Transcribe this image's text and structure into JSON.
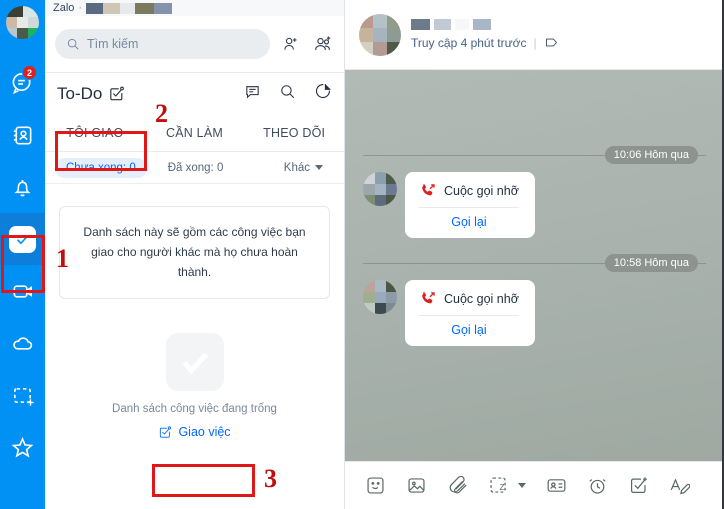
{
  "app": {
    "title": "Zalo",
    "accent": "#0190f3",
    "link_color": "#0068ff",
    "annotation_color": "#e11717"
  },
  "rail": {
    "avatar": {
      "name": "user-avatar"
    },
    "items": [
      {
        "name": "messages-icon",
        "label": "Tin nhắn",
        "badge": "2"
      },
      {
        "name": "contacts-icon",
        "label": "Danh bạ",
        "badge": ""
      },
      {
        "name": "notifications-bell-icon",
        "label": "Thông báo",
        "badge": ""
      },
      {
        "name": "todo-checkbox-icon",
        "label": "To-Do",
        "badge": "",
        "active": true
      },
      {
        "name": "video-camera-icon",
        "label": "Video",
        "badge": ""
      },
      {
        "name": "cloud-icon",
        "label": "Cloud",
        "badge": ""
      },
      {
        "name": "screen-capture-icon",
        "label": "Chụp màn hình",
        "badge": ""
      },
      {
        "name": "star-icon",
        "label": "Yêu thích",
        "badge": ""
      }
    ]
  },
  "search": {
    "placeholder": "Tìm kiếm",
    "add_friend": "Thêm bạn",
    "add_group": "Tạo nhóm"
  },
  "todo": {
    "title": "To-Do",
    "actions": [
      {
        "name": "note-icon",
        "label": "Ghi chú"
      },
      {
        "name": "search-icon",
        "label": "Tìm kiếm"
      },
      {
        "name": "chart-icon",
        "label": "Thống kê"
      }
    ],
    "tabs": [
      {
        "label": "TÔI GIAO",
        "active": true
      },
      {
        "label": "CẦN LÀM",
        "active": false
      },
      {
        "label": "THEO DÕI",
        "active": false
      }
    ],
    "filters": [
      {
        "label": "Chưa xong: 0",
        "active": true
      },
      {
        "label": "Đã xong: 0",
        "active": false
      }
    ],
    "more_label": "Khác",
    "tooltip": "Danh sách này sẽ gồm các công việc bạn giao cho người khác mà họ chưa hoàn thành.",
    "empty_text": "Danh sách công việc đang trống",
    "assign_label": "Giao việc"
  },
  "chat": {
    "status": "Truy cập 4 phút trước",
    "tag_icon": "tag-icon",
    "messages": [
      {
        "time": "10:06 Hôm qua",
        "label": "Cuộc gọi nhỡ",
        "action": "Gọi lại"
      },
      {
        "time": "10:58 Hôm qua",
        "label": "Cuộc gọi nhỡ",
        "action": "Gọi lại"
      }
    ],
    "toolbar": [
      {
        "name": "sticker-icon",
        "label": "Sticker"
      },
      {
        "name": "image-icon",
        "label": "Hình ảnh"
      },
      {
        "name": "attachment-clip-icon",
        "label": "Đính kèm"
      },
      {
        "name": "zalo-sticker-icon",
        "label": "Zalo"
      },
      {
        "name": "business-card-icon",
        "label": "Danh thiếp"
      },
      {
        "name": "reminder-clock-icon",
        "label": "Nhắc hẹn"
      },
      {
        "name": "create-task-icon",
        "label": "Tạo công việc"
      },
      {
        "name": "text-format-icon",
        "label": "Định dạng"
      }
    ]
  },
  "annotations": [
    {
      "number": "1",
      "target": "todo-rail-item"
    },
    {
      "number": "2",
      "target": "tab-toi-giao"
    },
    {
      "number": "3",
      "target": "assign-task-link"
    }
  ]
}
